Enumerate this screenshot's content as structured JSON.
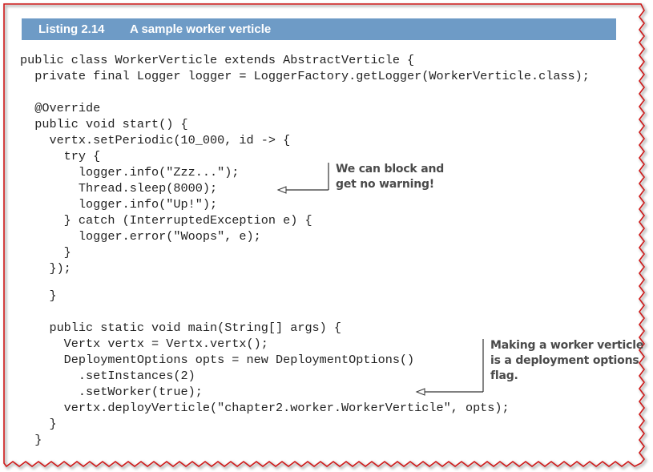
{
  "listing": {
    "number": "Listing 2.14",
    "title": "A sample worker verticle"
  },
  "code_lines": [
    "public class WorkerVerticle extends AbstractVerticle {",
    "  private final Logger logger = LoggerFactory.getLogger(WorkerVerticle.class);",
    "",
    "  @Override",
    "  public void start() {",
    "    vertx.setPeriodic(10_000, id -> {",
    "      try {",
    "        logger.info(\"Zzz...\");",
    "        Thread.sleep(8000);",
    "        logger.info(\"Up!\");",
    "      } catch (InterruptedException e) {",
    "        logger.error(\"Woops\", e);",
    "      }",
    "    });",
    "    }",
    "    public static void main(String[] args) {",
    "      Vertx vertx = Vertx.vertx();",
    "      DeploymentOptions opts = new DeploymentOptions()",
    "        .setInstances(2)",
    "        .setWorker(true);",
    "      vertx.deployVerticle(\"chapter2.worker.WorkerVerticle\", opts);",
    "    }",
    "  }"
  ],
  "annotations": {
    "block_note": {
      "line1": "We can block and",
      "line2": "get no warning!"
    },
    "worker_note": {
      "line1": "Making a worker verticle",
      "line2": "is a deployment options",
      "line3": "flag."
    }
  },
  "colors": {
    "header_bg": "#6e9bc6",
    "border": "#d01818",
    "code_text": "#222222",
    "annotation_text": "#4a4a4a"
  }
}
